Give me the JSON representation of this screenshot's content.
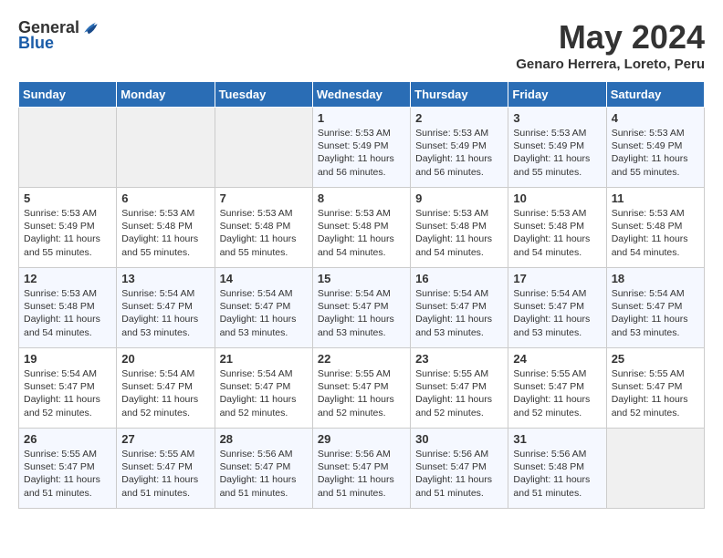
{
  "header": {
    "logo_general": "General",
    "logo_blue": "Blue",
    "month_year": "May 2024",
    "location": "Genaro Herrera, Loreto, Peru"
  },
  "weekdays": [
    "Sunday",
    "Monday",
    "Tuesday",
    "Wednesday",
    "Thursday",
    "Friday",
    "Saturday"
  ],
  "weeks": [
    [
      {
        "day": "",
        "sunrise": "",
        "sunset": "",
        "daylight": ""
      },
      {
        "day": "",
        "sunrise": "",
        "sunset": "",
        "daylight": ""
      },
      {
        "day": "",
        "sunrise": "",
        "sunset": "",
        "daylight": ""
      },
      {
        "day": "1",
        "sunrise": "Sunrise: 5:53 AM",
        "sunset": "Sunset: 5:49 PM",
        "daylight": "Daylight: 11 hours and 56 minutes."
      },
      {
        "day": "2",
        "sunrise": "Sunrise: 5:53 AM",
        "sunset": "Sunset: 5:49 PM",
        "daylight": "Daylight: 11 hours and 56 minutes."
      },
      {
        "day": "3",
        "sunrise": "Sunrise: 5:53 AM",
        "sunset": "Sunset: 5:49 PM",
        "daylight": "Daylight: 11 hours and 55 minutes."
      },
      {
        "day": "4",
        "sunrise": "Sunrise: 5:53 AM",
        "sunset": "Sunset: 5:49 PM",
        "daylight": "Daylight: 11 hours and 55 minutes."
      }
    ],
    [
      {
        "day": "5",
        "sunrise": "Sunrise: 5:53 AM",
        "sunset": "Sunset: 5:49 PM",
        "daylight": "Daylight: 11 hours and 55 minutes."
      },
      {
        "day": "6",
        "sunrise": "Sunrise: 5:53 AM",
        "sunset": "Sunset: 5:48 PM",
        "daylight": "Daylight: 11 hours and 55 minutes."
      },
      {
        "day": "7",
        "sunrise": "Sunrise: 5:53 AM",
        "sunset": "Sunset: 5:48 PM",
        "daylight": "Daylight: 11 hours and 55 minutes."
      },
      {
        "day": "8",
        "sunrise": "Sunrise: 5:53 AM",
        "sunset": "Sunset: 5:48 PM",
        "daylight": "Daylight: 11 hours and 54 minutes."
      },
      {
        "day": "9",
        "sunrise": "Sunrise: 5:53 AM",
        "sunset": "Sunset: 5:48 PM",
        "daylight": "Daylight: 11 hours and 54 minutes."
      },
      {
        "day": "10",
        "sunrise": "Sunrise: 5:53 AM",
        "sunset": "Sunset: 5:48 PM",
        "daylight": "Daylight: 11 hours and 54 minutes."
      },
      {
        "day": "11",
        "sunrise": "Sunrise: 5:53 AM",
        "sunset": "Sunset: 5:48 PM",
        "daylight": "Daylight: 11 hours and 54 minutes."
      }
    ],
    [
      {
        "day": "12",
        "sunrise": "Sunrise: 5:53 AM",
        "sunset": "Sunset: 5:48 PM",
        "daylight": "Daylight: 11 hours and 54 minutes."
      },
      {
        "day": "13",
        "sunrise": "Sunrise: 5:54 AM",
        "sunset": "Sunset: 5:47 PM",
        "daylight": "Daylight: 11 hours and 53 minutes."
      },
      {
        "day": "14",
        "sunrise": "Sunrise: 5:54 AM",
        "sunset": "Sunset: 5:47 PM",
        "daylight": "Daylight: 11 hours and 53 minutes."
      },
      {
        "day": "15",
        "sunrise": "Sunrise: 5:54 AM",
        "sunset": "Sunset: 5:47 PM",
        "daylight": "Daylight: 11 hours and 53 minutes."
      },
      {
        "day": "16",
        "sunrise": "Sunrise: 5:54 AM",
        "sunset": "Sunset: 5:47 PM",
        "daylight": "Daylight: 11 hours and 53 minutes."
      },
      {
        "day": "17",
        "sunrise": "Sunrise: 5:54 AM",
        "sunset": "Sunset: 5:47 PM",
        "daylight": "Daylight: 11 hours and 53 minutes."
      },
      {
        "day": "18",
        "sunrise": "Sunrise: 5:54 AM",
        "sunset": "Sunset: 5:47 PM",
        "daylight": "Daylight: 11 hours and 53 minutes."
      }
    ],
    [
      {
        "day": "19",
        "sunrise": "Sunrise: 5:54 AM",
        "sunset": "Sunset: 5:47 PM",
        "daylight": "Daylight: 11 hours and 52 minutes."
      },
      {
        "day": "20",
        "sunrise": "Sunrise: 5:54 AM",
        "sunset": "Sunset: 5:47 PM",
        "daylight": "Daylight: 11 hours and 52 minutes."
      },
      {
        "day": "21",
        "sunrise": "Sunrise: 5:54 AM",
        "sunset": "Sunset: 5:47 PM",
        "daylight": "Daylight: 11 hours and 52 minutes."
      },
      {
        "day": "22",
        "sunrise": "Sunrise: 5:55 AM",
        "sunset": "Sunset: 5:47 PM",
        "daylight": "Daylight: 11 hours and 52 minutes."
      },
      {
        "day": "23",
        "sunrise": "Sunrise: 5:55 AM",
        "sunset": "Sunset: 5:47 PM",
        "daylight": "Daylight: 11 hours and 52 minutes."
      },
      {
        "day": "24",
        "sunrise": "Sunrise: 5:55 AM",
        "sunset": "Sunset: 5:47 PM",
        "daylight": "Daylight: 11 hours and 52 minutes."
      },
      {
        "day": "25",
        "sunrise": "Sunrise: 5:55 AM",
        "sunset": "Sunset: 5:47 PM",
        "daylight": "Daylight: 11 hours and 52 minutes."
      }
    ],
    [
      {
        "day": "26",
        "sunrise": "Sunrise: 5:55 AM",
        "sunset": "Sunset: 5:47 PM",
        "daylight": "Daylight: 11 hours and 51 minutes."
      },
      {
        "day": "27",
        "sunrise": "Sunrise: 5:55 AM",
        "sunset": "Sunset: 5:47 PM",
        "daylight": "Daylight: 11 hours and 51 minutes."
      },
      {
        "day": "28",
        "sunrise": "Sunrise: 5:56 AM",
        "sunset": "Sunset: 5:47 PM",
        "daylight": "Daylight: 11 hours and 51 minutes."
      },
      {
        "day": "29",
        "sunrise": "Sunrise: 5:56 AM",
        "sunset": "Sunset: 5:47 PM",
        "daylight": "Daylight: 11 hours and 51 minutes."
      },
      {
        "day": "30",
        "sunrise": "Sunrise: 5:56 AM",
        "sunset": "Sunset: 5:47 PM",
        "daylight": "Daylight: 11 hours and 51 minutes."
      },
      {
        "day": "31",
        "sunrise": "Sunrise: 5:56 AM",
        "sunset": "Sunset: 5:48 PM",
        "daylight": "Daylight: 11 hours and 51 minutes."
      },
      {
        "day": "",
        "sunrise": "",
        "sunset": "",
        "daylight": ""
      }
    ]
  ]
}
